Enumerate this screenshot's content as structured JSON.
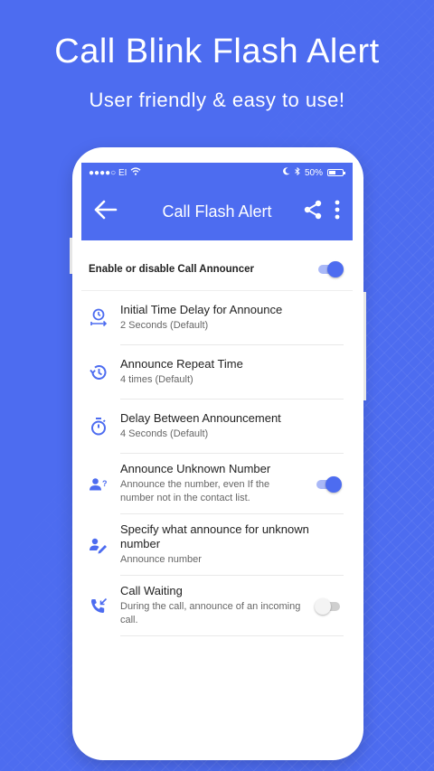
{
  "promo": {
    "title": "Call Blink Flash Alert",
    "subtitle": "User friendly & easy to use!"
  },
  "status_bar": {
    "carrier": "●●●●○ EI",
    "battery": "50%",
    "battery_level": 0.5
  },
  "app_bar": {
    "title": "Call Flash Alert",
    "icons": {
      "back": "arrow-back-icon",
      "share": "share-icon",
      "menu": "more-vert-icon"
    }
  },
  "master": {
    "label": "Enable or disable Call Announcer",
    "enabled": true
  },
  "settings": [
    {
      "title": "Initial Time Delay for Announce",
      "subtitle": "2 Seconds (Default)",
      "icon": "clock-delay-icon"
    },
    {
      "title": "Announce Repeat Time",
      "subtitle": "4 times (Default)",
      "icon": "history-icon"
    },
    {
      "title": "Delay Between Announcement",
      "subtitle": "4 Seconds (Default)",
      "icon": "timer-icon"
    },
    {
      "title": "Announce Unknown Number",
      "subtitle": "Announce the number, even If the number not in the contact list.",
      "icon": "unknown-person-icon",
      "toggle": true
    },
    {
      "title": "Specify what announce for unknown number",
      "subtitle": "Announce number",
      "icon": "person-edit-icon"
    },
    {
      "title": "Call Waiting",
      "subtitle": "During the call, announce of an incoming call.",
      "icon": "call-waiting-icon",
      "toggle": false
    }
  ],
  "colors": {
    "primary": "#4d6cf0",
    "toggle_on_track": "#a9b8f7",
    "toggle_off_track": "#cfcfcf"
  }
}
